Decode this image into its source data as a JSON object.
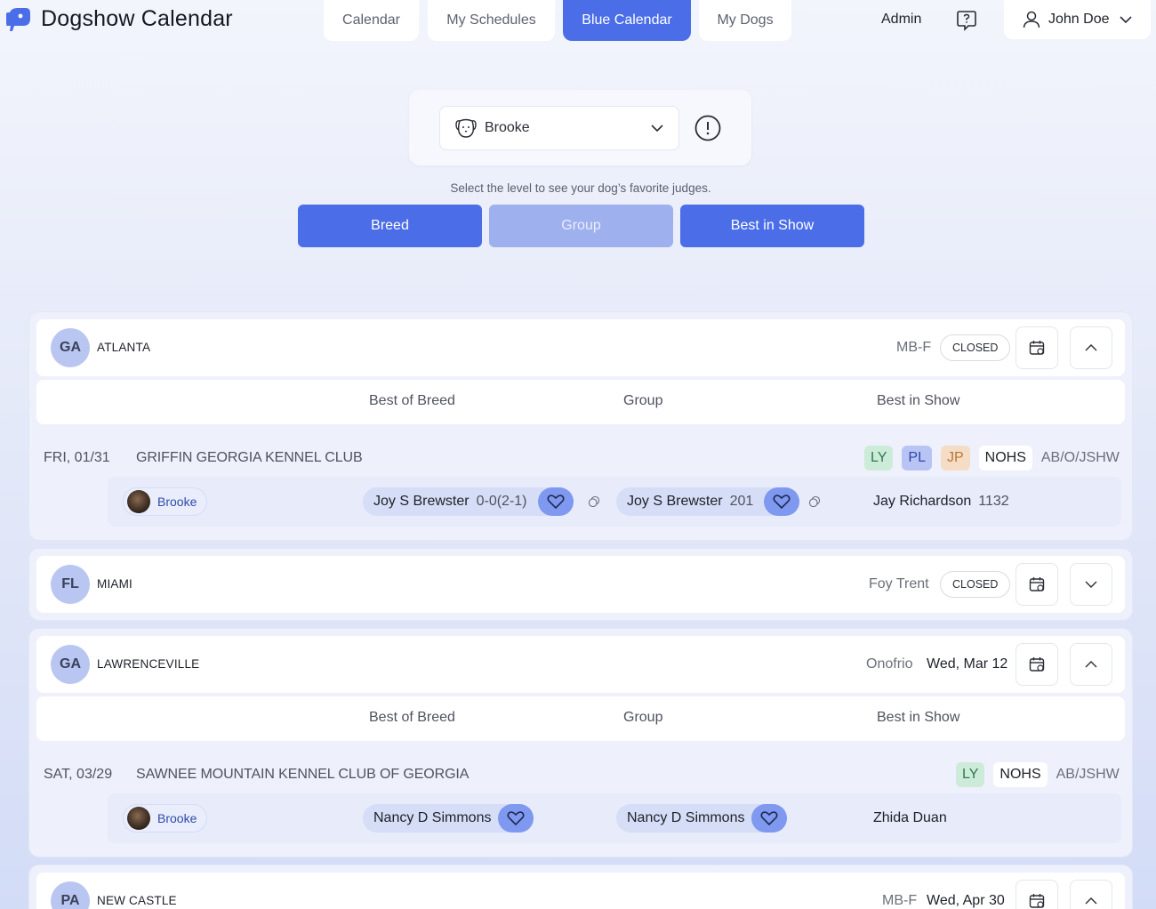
{
  "app": {
    "title": "Dogshow Calendar"
  },
  "nav": {
    "tabs": [
      {
        "label": "Calendar",
        "active": false
      },
      {
        "label": "My Schedules",
        "active": false
      },
      {
        "label": "Blue Calendar",
        "active": true
      },
      {
        "label": "My Dogs",
        "active": false
      }
    ],
    "admin": "Admin",
    "user": "John Doe"
  },
  "dog_select": {
    "value": "Brooke"
  },
  "levels": {
    "hint": "Select the level to see your dog’s favorite judges.",
    "items": [
      {
        "label": "Breed",
        "enabled": true
      },
      {
        "label": "Group",
        "enabled": false
      },
      {
        "label": "Best in Show",
        "enabled": true
      }
    ]
  },
  "shows": [
    {
      "state": "GA",
      "city": "ATLANTA",
      "meta": "MB-F",
      "status": "CLOSED",
      "expanded": true,
      "columns": [
        "Best of Breed",
        "Group",
        "Best in Show"
      ],
      "events": [
        {
          "date": "FRI, 01/31",
          "club": "GRIFFIN GEORGIA KENNEL CLUB",
          "tags": [
            "LY",
            "PL",
            "JP",
            "NOHS"
          ],
          "restriction": "AB/O/JSHW",
          "dog": "Brooke",
          "bob": {
            "judge": "Joy S Brewster",
            "score": "0-0(2-1)"
          },
          "group": {
            "judge": "Joy S Brewster",
            "score": "201"
          },
          "bis": {
            "judge": "Jay Richardson",
            "score": "1132"
          }
        }
      ]
    },
    {
      "state": "FL",
      "city": "MIAMI",
      "meta": "Foy Trent",
      "status": "CLOSED",
      "expanded": false
    },
    {
      "state": "GA",
      "city": "LAWRENCEVILLE",
      "meta": "Onofrio",
      "date": "Wed, Mar 12",
      "expanded": true,
      "columns": [
        "Best of Breed",
        "Group",
        "Best in Show"
      ],
      "events": [
        {
          "date": "SAT, 03/29",
          "club": "SAWNEE MOUNTAIN KENNEL CLUB OF GEORGIA",
          "tags": [
            "LY",
            "NOHS"
          ],
          "restriction": "AB/JSHW",
          "dog": "Brooke",
          "bob": {
            "judge": "Nancy D Simmons"
          },
          "group": {
            "judge": "Nancy D Simmons"
          },
          "bis": {
            "judge": "Zhida Duan"
          }
        }
      ]
    },
    {
      "state": "PA",
      "city": "NEW CASTLE",
      "meta": "MB-F",
      "date": "Wed, Apr 30",
      "expanded": true
    }
  ],
  "colors": {
    "accent": "#4b6ee8",
    "accent_dim": "#9eb0ee",
    "heart_bg": "#7f98f0",
    "state_avatar": "#b9c6f2"
  }
}
